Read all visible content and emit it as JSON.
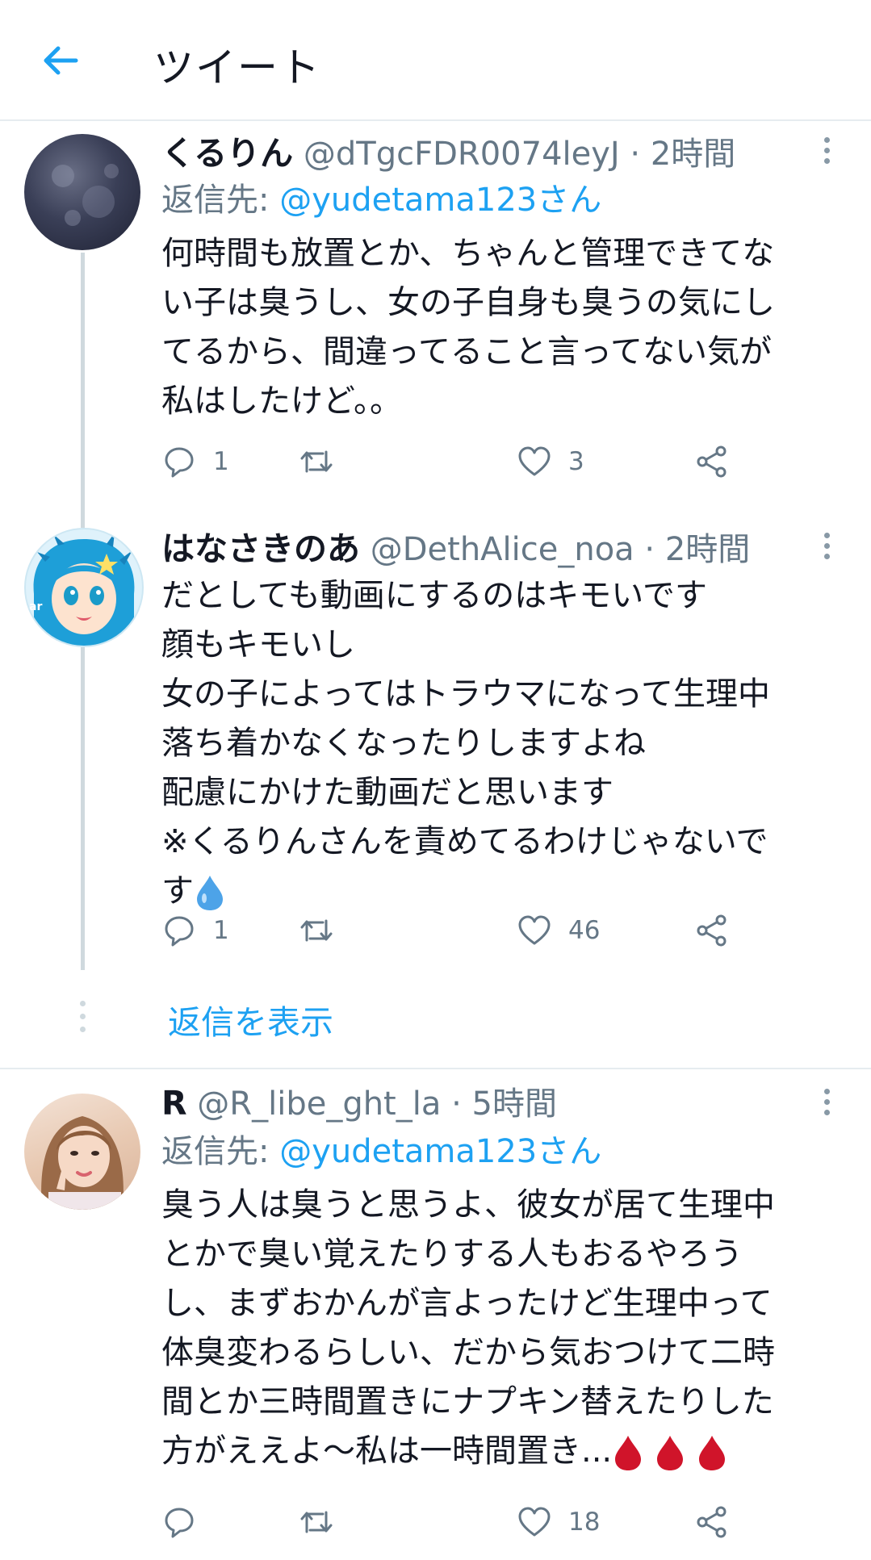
{
  "header": {
    "title": "ツイート"
  },
  "tweets": [
    {
      "name": "くるりん",
      "handle": "@dTgcFDR0074leyJ",
      "separator": "·",
      "time": "2時間",
      "replying_prefix": "返信先:",
      "replying_to": "@yudetama123さん",
      "lines": [
        "何時間も放置とか、ちゃんと管理できてな",
        "い子は臭うし、女の子自身も臭うの気にし",
        "てるから、間違ってること言ってない気が",
        "私はしたけど。。"
      ],
      "reply_count": "1",
      "like_count": "3"
    },
    {
      "name": "はなさきのあ",
      "handle": "@DethAlice_noa",
      "separator": "·",
      "time": "2時間",
      "lines": [
        "だとしても動画にするのはキモいです",
        "顔もキモいし",
        "女の子によってはトラウマになって生理中",
        "落ち着かなくなったりしますよね",
        "配慮にかけた動画だと思います",
        "※くるりんさんを責めてるわけじゃないで",
        "す"
      ],
      "emoji": "droplet-emoji",
      "reply_count": "1",
      "like_count": "46",
      "show_replies": "返信を表示"
    },
    {
      "name": "R",
      "handle": "@R_libe_ght_la",
      "separator": "·",
      "time": "5時間",
      "replying_prefix": "返信先:",
      "replying_to": "@yudetama123さん",
      "lines": [
        "臭う人は臭うと思うよ、彼女が居て生理中",
        "とかで臭い覚えたりする人もおるやろう",
        "し、まずおかんが言よったけど生理中って",
        "体臭変わるらしい、だから気おつけて二時",
        "間とか三時間置きにナプキン替えたりした",
        "方がええよ〜私は一時間置き..."
      ],
      "emoji": "blood-drop-emoji",
      "like_count": "18"
    }
  ],
  "colors": {
    "accent": "#1da1f2",
    "secondary_text": "#657786",
    "icon": "#657786",
    "divider": "#e6ecf0",
    "thread_line": "#cfd9de",
    "blood_drop": "#d0142a",
    "water_drop": "#4da3e8"
  }
}
